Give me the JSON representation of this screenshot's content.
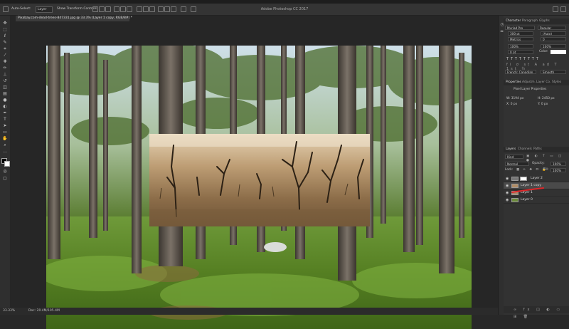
{
  "app": {
    "title": "Adobe Photoshop CC 2017"
  },
  "options_bar": {
    "auto_select_label": "Auto-Select:",
    "auto_select_value": "Layer",
    "show_transform_label": "Show Transform Controls"
  },
  "document": {
    "tab_label": "Pixabay.com-dead-trees-847331.jpg @ 33.3% (Layer 1 copy, RGB/8#) *"
  },
  "status": {
    "zoom": "33.33%",
    "doc_size": "Doc: 20.4M/105.4M"
  },
  "panels": {
    "character_tabs": [
      "Character",
      "Paragraph",
      "Glyphs"
    ],
    "character": {
      "font": "Myriad Pro",
      "style": "Regular",
      "size": "300 pt",
      "leading": "(Auto)",
      "tracking": "0",
      "kerning": "Metrics",
      "vscale": "100%",
      "hscale": "100%",
      "baseline": "0 pt",
      "color_label": "Color:",
      "language": "French: Canadian",
      "aa": "Smooth"
    },
    "properties_tabs": [
      "Properties",
      "Adjustm.",
      "Layer Co.",
      "Styles"
    ],
    "properties": {
      "title": "Pixel Layer Properties",
      "w": "W: 3194 px",
      "h": "H: 2450 px",
      "x": "X: 0 px",
      "y": "Y: 0 px"
    },
    "layers_tabs": [
      "Layers",
      "Channels",
      "Paths"
    ],
    "layers_kind": "Kind",
    "blend_mode": "Normal",
    "opacity_label": "Opacity:",
    "opacity_value": "100%",
    "lock_label": "Lock:",
    "fill_label": "Fill:",
    "fill_value": "100%",
    "layers": [
      {
        "name": "Layer 2",
        "selected": false
      },
      {
        "name": "Layer 1 copy",
        "selected": true
      },
      {
        "name": "Layer 1",
        "selected": false
      },
      {
        "name": "Layer 0",
        "selected": false
      }
    ]
  },
  "colors": {
    "annotation_red": "#e0282a",
    "selection": "#4a4a4a"
  }
}
